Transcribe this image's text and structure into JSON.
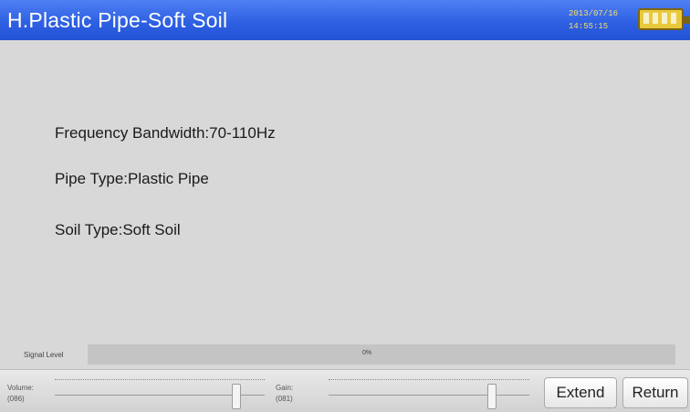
{
  "header": {
    "title": "H.Plastic Pipe-Soft Soil",
    "date": "2013/07/16",
    "time": "14:55:15",
    "battery_icon": "battery-full-icon",
    "battery_level": 1.0
  },
  "main": {
    "frequency": "Frequency Bandwidth:70-110Hz",
    "pipe_type": "Pipe Type:Plastic Pipe",
    "soil_type": "Soil Type:Soft Soil"
  },
  "signal": {
    "label": "Signal Level",
    "value": "0%"
  },
  "controls": {
    "volume_label": "Volume:",
    "volume_value": "(086)",
    "volume_level": 86,
    "gain_label": "Gain:",
    "gain_value": "(081)",
    "gain_level": 81,
    "extend_label": "Extend",
    "return_label": "Return"
  },
  "colors": {
    "titlebar": "#2f60e3",
    "title_text": "#ffffff",
    "datetime_text": "#f5e16a",
    "battery": "#e9c93c",
    "background": "#d8d8d8"
  }
}
